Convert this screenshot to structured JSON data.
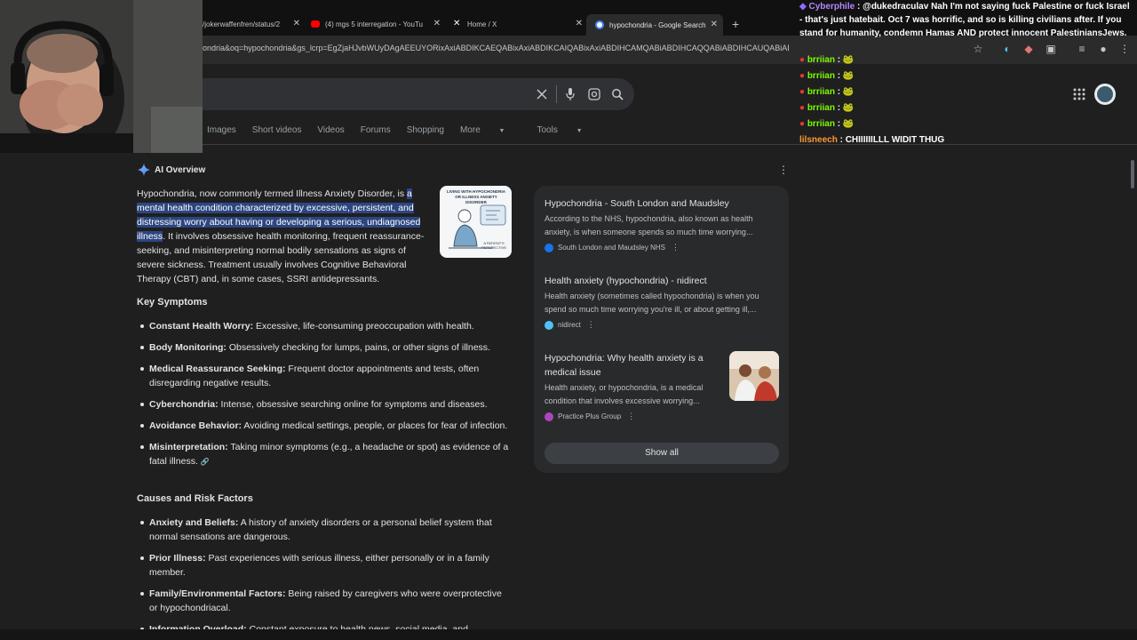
{
  "browser": {
    "tabs": [
      {
        "title": "/jokerwaffenfren/status/2",
        "fav_color": "#9aa0a6"
      },
      {
        "title": "(4) mgs 5 interregation - YouTu",
        "fav_color": "#ff0000"
      },
      {
        "title": "Home / X",
        "fav_color": "#ffffff"
      },
      {
        "title": "hypochondria - Google Search",
        "fav_color": "#4285f4"
      }
    ],
    "new_tab": "+",
    "url": "ondria&oq=hypochondria&gs_lcrp=EgZjaHJvbWUyDAgAEEUYORixAxiABDIKCAEQABixAxiABDIKCAIQABixAxiABDIHCAMQABiABDIHCAQQABiABDIHCAUQABiABDIHCAcQABiABDIHCAcQABiABDIHCAgQABiABDIHCAkQABiAB..."
  },
  "chat": [
    {
      "user": "Cyberphile",
      "color": "#b388ff",
      "text": "@dukedraculav Nah I'm not saying fuck Palestine or fuck Israel - that's just hatebait. Oct 7 was horrific, and so is killing civilians after. If you stand for humanity, condemn Hamas AND protect innocent PalestiniansJews."
    },
    {
      "user": "brriian",
      "color": "#7cfc00",
      "text": "🐸"
    },
    {
      "user": "brriian",
      "color": "#7cfc00",
      "text": "🐸"
    },
    {
      "user": "brriian",
      "color": "#7cfc00",
      "text": "🐸"
    },
    {
      "user": "brriian",
      "color": "#7cfc00",
      "text": "🐸"
    },
    {
      "user": "brriian",
      "color": "#7cfc00",
      "text": "🐸"
    },
    {
      "user": "lilsneech",
      "color": "#ff9933",
      "text": "CHIIIIIILLL WIDIT THUG"
    }
  ],
  "search": {
    "tabs": [
      "Images",
      "Short videos",
      "Videos",
      "Forums",
      "Shopping",
      "More",
      "Tools"
    ]
  },
  "ai_overview": {
    "label": "AI Overview",
    "intro_pre": "Hypochondria, now commonly termed Illness Anxiety Disorder, is ",
    "intro_highlight": "a mental health condition characterized by excessive, persistent, and distressing worry about having or developing a serious, undiagnosed illness",
    "intro_post": ". It involves obsessive health monitoring, frequent reassurance-seeking, and misinterpreting normal bodily sensations as signs of severe sickness. Treatment usually involves Cognitive Behavioral Therapy (CBT) and, in some cases, SSRI antidepressants.",
    "thumb_text_title": "LIVING WITH HYPOCHONDRIA OR ILLNESS ANXIETY DISORDER",
    "thumb_text_sub": "A PATIENT'S PERSPECTIVE",
    "key_symptoms_title": "Key Symptoms",
    "key_symptoms": [
      {
        "term": "Constant Health Worry:",
        "desc": " Excessive, life-consuming preoccupation with health."
      },
      {
        "term": "Body Monitoring:",
        "desc": " Obsessively checking for lumps, pains, or other signs of illness."
      },
      {
        "term": "Medical Reassurance Seeking:",
        "desc": " Frequent doctor appointments and tests, often disregarding negative results."
      },
      {
        "term": "Cyberchondria:",
        "desc": " Intense, obsessive searching online for symptoms and diseases."
      },
      {
        "term": "Avoidance Behavior:",
        "desc": " Avoiding medical settings, people, or places for fear of infection."
      },
      {
        "term": "Misinterpretation:",
        "desc": " Taking minor symptoms (e.g., a headache or spot) as evidence of a fatal illness."
      }
    ],
    "causes_title": "Causes and Risk Factors",
    "causes": [
      {
        "term": "Anxiety and Beliefs:",
        "desc": " A history of anxiety disorders or a personal belief system that normal sensations are dangerous."
      },
      {
        "term": "Prior Illness:",
        "desc": " Past experiences with serious illness, either personally or in a family member."
      },
      {
        "term": "Family/Environmental Factors:",
        "desc": " Being raised by caregivers who were overprotective or hypochondriacal."
      },
      {
        "term": "Information Overload:",
        "desc": " Constant exposure to health news, social media, and"
      }
    ]
  },
  "sources": [
    {
      "title": "Hypochondria - South London and Maudsley",
      "snippet": "According to the NHS, hypochondria, also known as health anxiety, is when someone spends so much time worrying...",
      "site": "South London and Maudsley NHS",
      "fav_color": "#1a73e8"
    },
    {
      "title": "Health anxiety (hypochondria) - nidirect",
      "snippet": "Health anxiety (sometimes called hypochondria) is when you spend so much time worrying you're ill, or about getting ill,...",
      "site": "nidirect",
      "fav_color": "#4fc3f7"
    },
    {
      "title": "Hypochondria: Why health anxiety is a medical issue",
      "snippet": "Health anxiety, or hypochondria, is a medical condition that involves excessive worrying...",
      "site": "Practice Plus Group",
      "fav_color": "#ab47bc"
    }
  ],
  "show_all": "Show all"
}
